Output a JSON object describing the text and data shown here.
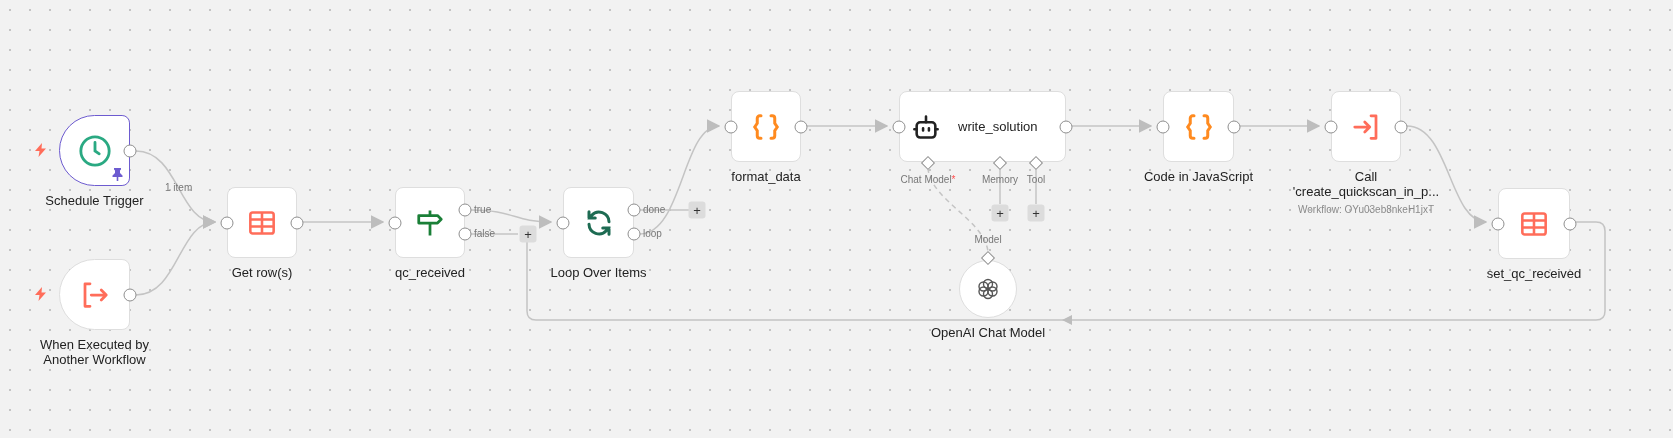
{
  "canvas": {
    "nodes": [
      {
        "kind": "trigger",
        "label": "Schedule Trigger",
        "pinned": true
      },
      {
        "kind": "trigger",
        "label": "When Executed by\nAnother Workflow",
        "pinned": false
      },
      {
        "kind": "action",
        "label": "Get row(s)",
        "pinned": false
      },
      {
        "kind": "action",
        "label": "qc_received",
        "pinned": false,
        "outputs": [
          {
            "label": "true"
          },
          {
            "label": "false",
            "add": "+"
          }
        ]
      },
      {
        "kind": "action",
        "label": "Loop Over Items",
        "pinned": false,
        "outputs": [
          {
            "label": "done",
            "add": "+"
          },
          {
            "label": "loop"
          }
        ]
      },
      {
        "kind": "action",
        "label": "format_data",
        "pinned": false
      },
      {
        "kind": "agent",
        "label": "write_solution",
        "pinned": false,
        "inputs": [
          {
            "label": "Chat Model",
            "required_mark": "*"
          },
          {
            "label": "Memory",
            "add": "+"
          },
          {
            "label": "Tool",
            "add": "+"
          }
        ]
      },
      {
        "kind": "model",
        "label": "OpenAI Chat Model",
        "pinned": false,
        "output_label": "Model"
      },
      {
        "kind": "action",
        "label": "Code in JavaScript",
        "pinned": false
      },
      {
        "kind": "action",
        "label": "Call\n'create_quickscan_in_p...",
        "subtitle": "Workflow: OYu03eb8nkeH1jxT",
        "pinned": false
      },
      {
        "kind": "action",
        "label": "set_qc_received",
        "pinned": false
      }
    ],
    "edge_labels": [
      {
        "text": "1 item"
      }
    ]
  }
}
